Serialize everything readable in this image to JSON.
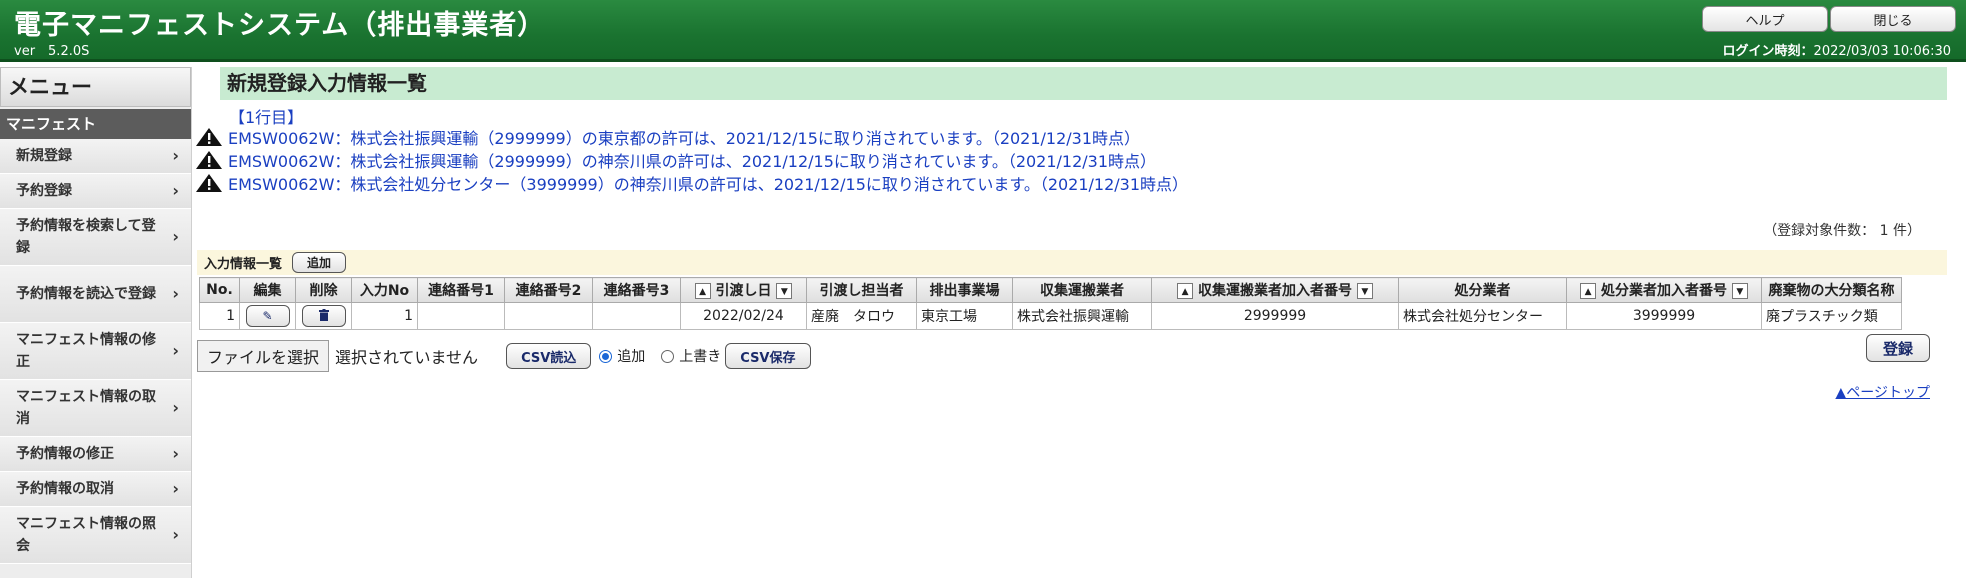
{
  "header": {
    "title": "電子マニフェストシステム（排出事業者）",
    "version": "ver　5.2.0S",
    "help_label": "ヘルプ",
    "close_label": "閉じる",
    "login_label": "ログイン時刻：",
    "login_time": "2022/03/03 10:06:30"
  },
  "sidebar": {
    "menu_title": "メニュー",
    "section": "マニフェスト",
    "items": [
      {
        "label": "新規登録"
      },
      {
        "label": "予約登録"
      },
      {
        "label": "予約情報を検索して登録"
      },
      {
        "label": "予約情報を読込で登録"
      },
      {
        "label": "マニフェスト情報の修正"
      },
      {
        "label": "マニフェスト情報の取消"
      },
      {
        "label": "予約情報の修正"
      },
      {
        "label": "予約情報の取消"
      },
      {
        "label": "マニフェスト情報の照会"
      }
    ]
  },
  "main": {
    "page_title": "新規登録入力情報一覧",
    "row_label": "【1行目】",
    "warnings": [
      "EMSW0062W：株式会社振興運輸（2999999）の東京都の許可は、2021/12/15に取り消されています。（2021/12/31時点）",
      "EMSW0062W：株式会社振興運輸（2999999）の神奈川県の許可は、2021/12/15に取り消されています。（2021/12/31時点）",
      "EMSW0062W：株式会社処分センター（3999999）の神奈川県の許可は、2021/12/15に取り消されています。（2021/12/31時点）"
    ],
    "count_text": "（登録対象件数： 1 件）",
    "list_label": "入力情報一覧",
    "add_label": "追加",
    "columns": [
      "No.",
      "編集",
      "削除",
      "入力No",
      "連絡番号1",
      "連絡番号2",
      "連絡番号3",
      "引渡し日",
      "引渡し担当者",
      "排出事業場",
      "収集運搬業者",
      "収集運搬業者加入者番号",
      "処分業者",
      "処分業者加入者番号",
      "廃棄物の大分類名称"
    ],
    "rows": [
      {
        "no": "1",
        "input_no": "1",
        "contact1": "",
        "contact2": "",
        "contact3": "",
        "delivery_date": "2022/02/24",
        "handler": "産廃　タロウ",
        "site": "東京工場",
        "carrier": "株式会社振興運輸",
        "carrier_no": "2999999",
        "disposer": "株式会社処分センター",
        "disposer_no": "3999999",
        "waste": "廃プラスチック類"
      }
    ],
    "file_button": "ファイルを選択",
    "file_status": "選択されていません",
    "csv_read": "CSV読込",
    "radio_add": "追加",
    "radio_overwrite": "上書き",
    "csv_save": "CSV保存",
    "register": "登録",
    "page_top": "▲ページトップ"
  }
}
